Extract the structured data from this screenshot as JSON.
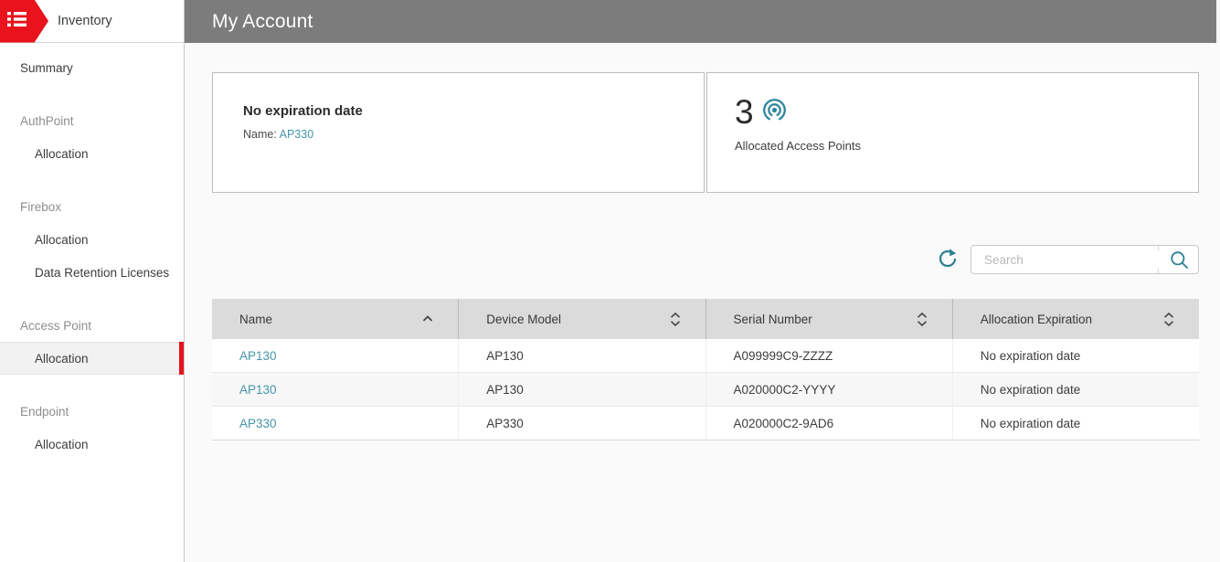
{
  "colors": {
    "accent_red": "#e8131d",
    "teal": "#2b859a",
    "link_teal": "#4596a9",
    "header_gray": "#7c7c7c"
  },
  "icons": {
    "sidebar_logo": "list-menu-icon",
    "allocated_card": "access-point-beacon-icon",
    "toolbar_refresh": "refresh-arrow-icon",
    "toolbar_search": "magnifier-icon",
    "sort_ascending": "chevron-up-icon",
    "sort_unsorted": "chevron-up-down-icon"
  },
  "sidebar": {
    "title": "Inventory",
    "items": [
      {
        "label": "Summary",
        "type": "top"
      },
      {
        "label": "AuthPoint",
        "type": "section"
      },
      {
        "label": "Allocation",
        "type": "subitem"
      },
      {
        "label": "Firebox",
        "type": "section"
      },
      {
        "label": "Allocation",
        "type": "subitem"
      },
      {
        "label": "Data Retention Licenses",
        "type": "subitem"
      },
      {
        "label": "Access Point",
        "type": "section"
      },
      {
        "label": "Allocation",
        "type": "subitem",
        "selected": true
      },
      {
        "label": "Endpoint",
        "type": "section"
      },
      {
        "label": "Allocation",
        "type": "subitem"
      }
    ]
  },
  "header": {
    "title": "My Account"
  },
  "cards": {
    "expiration": {
      "title": "No expiration date",
      "name_label": "Name:",
      "name_value": "AP330"
    },
    "allocated": {
      "count": "3",
      "label": "Allocated Access Points"
    }
  },
  "toolbar": {
    "search_placeholder": "Search",
    "search_value": ""
  },
  "table": {
    "columns": [
      {
        "label": "Name",
        "sort": "asc"
      },
      {
        "label": "Device Model",
        "sort": "none"
      },
      {
        "label": "Serial Number",
        "sort": "none"
      },
      {
        "label": "Allocation Expiration",
        "sort": "none"
      }
    ],
    "rows": [
      {
        "name": "AP130",
        "model": "AP130",
        "serial": "A099999C9-ZZZZ",
        "expiration": "No expiration date"
      },
      {
        "name": "AP130",
        "model": "AP130",
        "serial": "A020000C2-YYYY",
        "expiration": "No expiration date"
      },
      {
        "name": "AP330",
        "model": "AP330",
        "serial": "A020000C2-9AD6",
        "expiration": "No expiration date"
      }
    ]
  }
}
